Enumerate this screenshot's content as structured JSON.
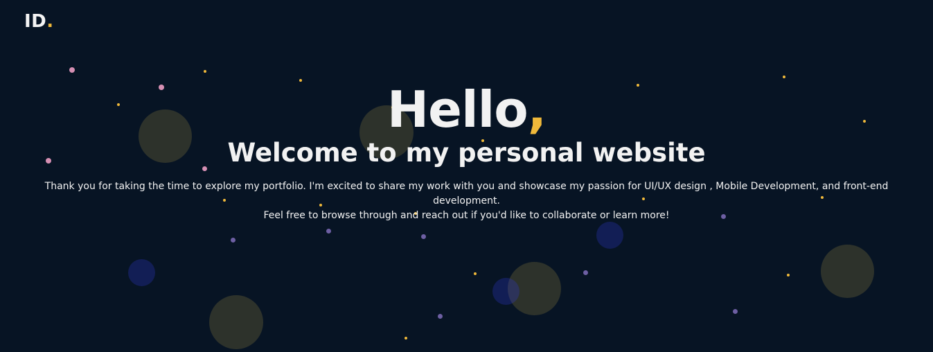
{
  "logo": {
    "text": "ID",
    "dot": "."
  },
  "hero": {
    "greeting": "Hello",
    "greeting_punct": ",",
    "subtitle": "Welcome to my personal website",
    "intro_line1": "Thank you for taking the time to explore my portfolio. I'm excited to share my work with you and showcase my passion for UI/UX design , Mobile Development, and front-end development.",
    "intro_line2": "Feel free to browse through and reach out if you'd like to collaborate or learn more!"
  },
  "colors": {
    "background": "#071424",
    "text": "#f2f2f2",
    "accent": "#f0b93a",
    "dot_pink": "#d58fb3",
    "dot_purple": "#6d5fa3"
  }
}
